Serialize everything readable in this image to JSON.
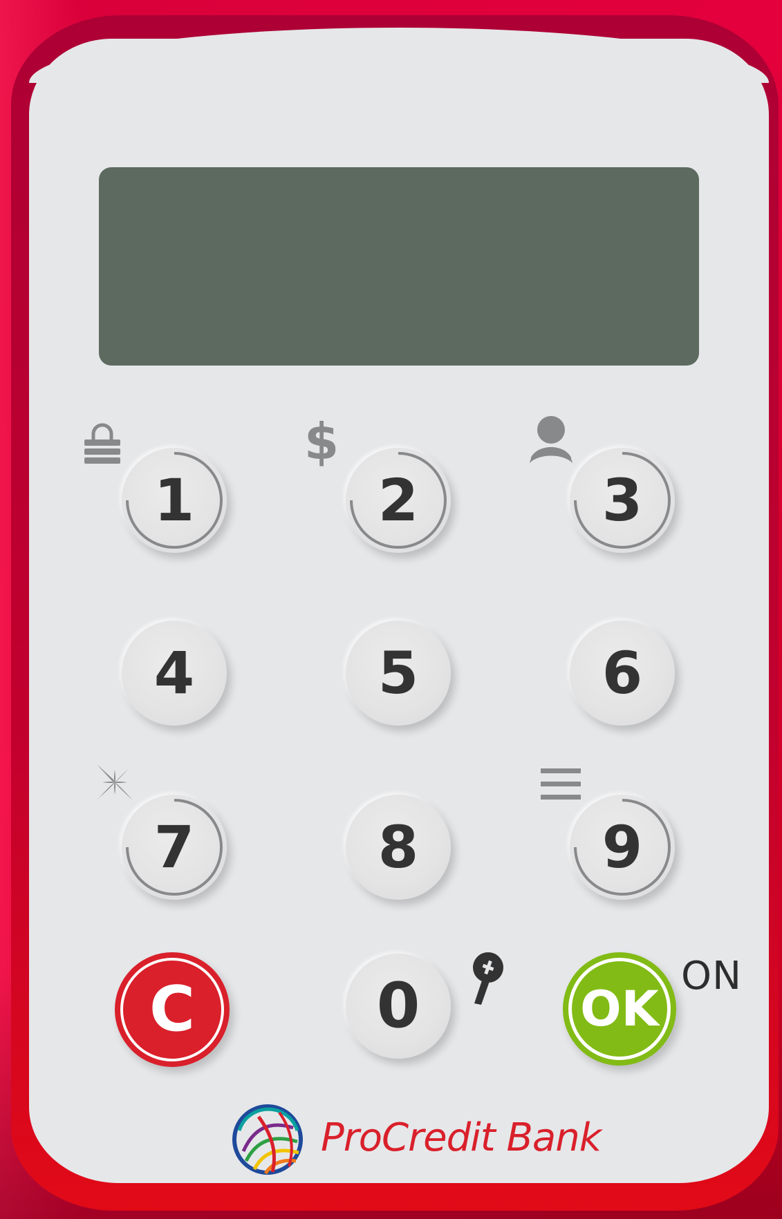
{
  "device": {
    "brand_name": "ProCredit Bank",
    "on_label": "ON",
    "screen_text": ""
  },
  "keypad": {
    "keys": [
      {
        "label": "1",
        "icon": "lock-icon"
      },
      {
        "label": "2",
        "icon": "dollar-icon"
      },
      {
        "label": "3",
        "icon": "user-icon"
      },
      {
        "label": "4"
      },
      {
        "label": "5"
      },
      {
        "label": "6"
      },
      {
        "label": "7",
        "icon": "sparkle-icon"
      },
      {
        "label": "8"
      },
      {
        "label": "9",
        "icon": "menu-icon"
      },
      {
        "label": "C"
      },
      {
        "label": "0",
        "icon": "key-icon"
      },
      {
        "label": "OK"
      }
    ]
  },
  "colors": {
    "background": "#dc0038",
    "body": "#e6e7e9",
    "screen": "#5d6a60",
    "key_text": "#333333",
    "cancel": "#d9202b",
    "ok": "#82bb15",
    "icon": "#88898b"
  }
}
